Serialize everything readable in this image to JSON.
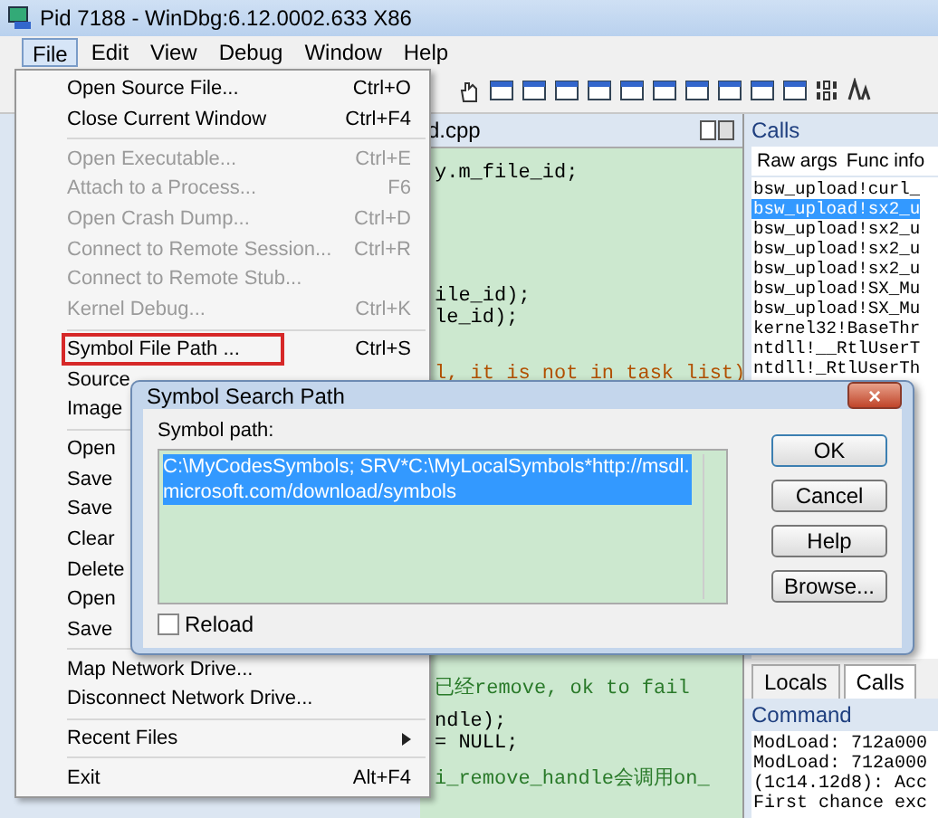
{
  "window": {
    "title": "Pid 7188 - WinDbg:6.12.0002.633 X86"
  },
  "menubar": [
    {
      "label": "File",
      "selected": true
    },
    {
      "label": "Edit",
      "selected": false
    },
    {
      "label": "View",
      "selected": false
    },
    {
      "label": "Debug",
      "selected": false
    },
    {
      "label": "Window",
      "selected": false
    },
    {
      "label": "Help",
      "selected": false
    }
  ],
  "source_window": {
    "title": "d.cpp",
    "lines_above": [
      "y.m_file_id;",
      "ile_id);",
      "le_id);",
      "l, it is not in task list)"
    ],
    "lines_below": [
      "已经remove, ok to fail",
      "ndle);",
      "= NULL;",
      "i_remove_handle会调用on_"
    ]
  },
  "calls_window": {
    "title": "Calls",
    "tabs": [
      "Raw args",
      "Func info"
    ],
    "rows": [
      {
        "text": "bsw_upload!curl_",
        "selected": false
      },
      {
        "text": "bsw_upload!sx2_u",
        "selected": true
      },
      {
        "text": "bsw_upload!sx2_u",
        "selected": false
      },
      {
        "text": "bsw_upload!sx2_u",
        "selected": false
      },
      {
        "text": "bsw_upload!sx2_u",
        "selected": false
      },
      {
        "text": "bsw_upload!SX_Mu",
        "selected": false
      },
      {
        "text": "bsw_upload!SX_Mu",
        "selected": false
      },
      {
        "text": "kernel32!BaseThr",
        "selected": false
      },
      {
        "text": "ntdll!__RtlUserT",
        "selected": false
      },
      {
        "text": "ntdll!_RtlUserTh",
        "selected": false
      }
    ]
  },
  "bottom_tabs": [
    {
      "label": "Locals",
      "selected": false
    },
    {
      "label": "Calls",
      "selected": true
    }
  ],
  "command_window": {
    "title": "Command",
    "lines": [
      "ModLoad: 712a000",
      "ModLoad: 712a000",
      "(1c14.12d8): Acc",
      "First chance exc"
    ]
  },
  "file_menu": [
    {
      "kind": "item",
      "label": "Open Source File...",
      "shortcut": "Ctrl+O",
      "disabled": false,
      "outlined": false
    },
    {
      "kind": "item",
      "label": "Close Current Window",
      "shortcut": "Ctrl+F4",
      "disabled": false,
      "outlined": false
    },
    {
      "kind": "separator"
    },
    {
      "kind": "item",
      "label": "Open Executable...",
      "shortcut": "Ctrl+E",
      "disabled": true,
      "outlined": false
    },
    {
      "kind": "item",
      "label": "Attach to a Process...",
      "shortcut": "F6",
      "disabled": true,
      "outlined": false
    },
    {
      "kind": "item",
      "label": "Open Crash Dump...",
      "shortcut": "Ctrl+D",
      "disabled": true,
      "outlined": false
    },
    {
      "kind": "item",
      "label": "Connect to Remote Session...",
      "shortcut": "Ctrl+R",
      "disabled": true,
      "outlined": false
    },
    {
      "kind": "item",
      "label": "Connect to Remote Stub...",
      "disabled": true,
      "outlined": false
    },
    {
      "kind": "item",
      "label": "Kernel Debug...",
      "shortcut": "Ctrl+K",
      "disabled": true,
      "outlined": false
    },
    {
      "kind": "separator"
    },
    {
      "kind": "item",
      "label": "Symbol File Path ...",
      "shortcut": "Ctrl+S",
      "disabled": false,
      "outlined": true
    },
    {
      "kind": "item",
      "label": "Source",
      "disabled": false,
      "outlined": false
    },
    {
      "kind": "item",
      "label": "Image",
      "disabled": false,
      "outlined": false
    },
    {
      "kind": "separator"
    },
    {
      "kind": "item",
      "label": "Open",
      "disabled": false,
      "outlined": false
    },
    {
      "kind": "item",
      "label": "Save",
      "disabled": false,
      "outlined": false
    },
    {
      "kind": "item",
      "label": "Save",
      "disabled": false,
      "outlined": false
    },
    {
      "kind": "item",
      "label": "Clear",
      "disabled": false,
      "outlined": false
    },
    {
      "kind": "item",
      "label": "Delete",
      "disabled": false,
      "outlined": false
    },
    {
      "kind": "item",
      "label": "Open",
      "disabled": false,
      "outlined": false
    },
    {
      "kind": "item",
      "label": "Save",
      "disabled": false,
      "outlined": false
    },
    {
      "kind": "separator"
    },
    {
      "kind": "item",
      "label": "Map Network Drive...",
      "disabled": false,
      "outlined": false
    },
    {
      "kind": "item",
      "label": "Disconnect Network Drive...",
      "disabled": false,
      "outlined": false
    },
    {
      "kind": "separator"
    },
    {
      "kind": "item",
      "label": "Recent Files",
      "disabled": false,
      "outlined": false,
      "submenu": true
    },
    {
      "kind": "separator"
    },
    {
      "kind": "item",
      "label": "Exit",
      "shortcut": "Alt+F4",
      "disabled": false,
      "outlined": false
    }
  ],
  "dialog": {
    "title": "Symbol Search Path",
    "close": "×",
    "field_label": "Symbol path:",
    "value": "C:\\MyCodesSymbols; SRV*C:\\MyLocalSymbols*http://msdl.microsoft.com/download/symbols",
    "buttons": [
      "OK",
      "Cancel",
      "Help",
      "Browse..."
    ],
    "reload": {
      "label": "Reload",
      "checked": false
    }
  }
}
